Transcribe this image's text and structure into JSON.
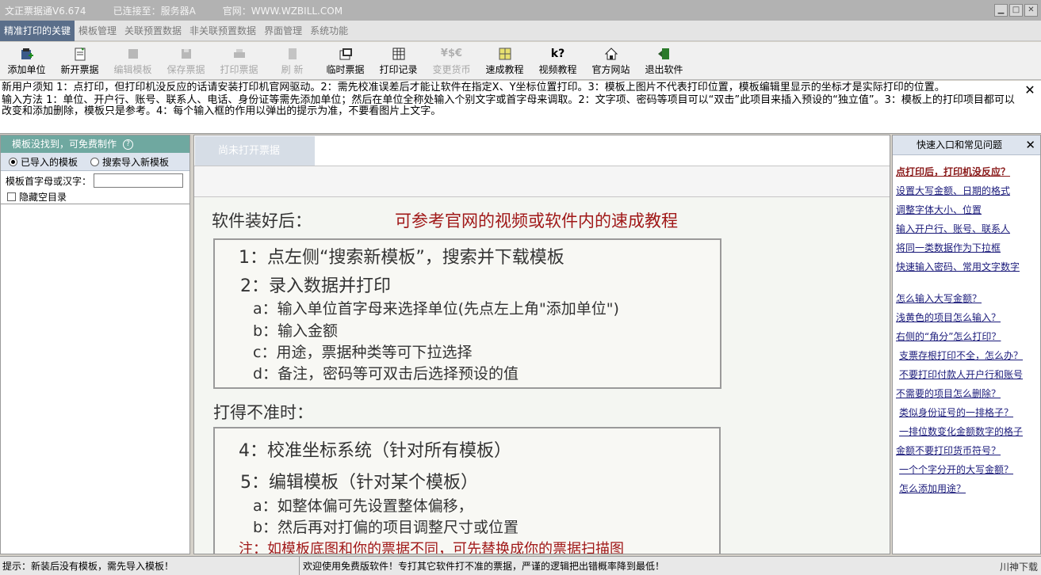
{
  "titlebar": {
    "app_title": "文正票据通V6.674",
    "connection": "已连接至：服务器A",
    "website": "官网：WWW.WZBILL.COM",
    "minimize": "▁",
    "restore": "□",
    "close": "✕"
  },
  "menubar": {
    "items": [
      "精准打印的关键",
      "模板管理",
      "关联预置数据",
      "非关联预置数据",
      "界面管理",
      "系统功能"
    ]
  },
  "toolbar": {
    "buttons": [
      {
        "label": "添加单位",
        "icon": "add-unit-icon"
      },
      {
        "label": "新开票据",
        "icon": "new-bill-icon"
      },
      {
        "label": "编辑模板",
        "icon": "edit-template-icon"
      },
      {
        "label": "保存票据",
        "icon": "save-bill-icon"
      },
      {
        "label": "打印票据",
        "icon": "print-bill-icon"
      },
      {
        "label": "刷 新",
        "icon": "refresh-icon"
      },
      {
        "label": "临时票据",
        "icon": "temp-bill-icon"
      },
      {
        "label": "打印记录",
        "icon": "print-record-icon"
      },
      {
        "label": "变更货币",
        "icon": "currency-icon"
      },
      {
        "label": "速成教程",
        "icon": "tutorial-icon"
      },
      {
        "label": "视频教程",
        "icon": "video-tutorial-icon"
      },
      {
        "label": "官方网站",
        "icon": "home-icon"
      },
      {
        "label": "退出软件",
        "icon": "exit-icon"
      }
    ]
  },
  "notice": {
    "line1": "新用户须知 1：点打印，但打印机没反应的话请安装打印机官网驱动。2：需先校准误差后才能让软件在指定X、Y坐标位置打印。3：模板上图片不代表打印位置，模板编辑里显示的坐标才是实际打印的位置。",
    "line2": "输入方法 1：单位、开户行、账号、联系人、电话、身份证等需先添加单位；然后在单位全称处输入个别文字或首字母来调取。2：文字项、密码等项目可以“双击”此项目来插入预设的“独立值”。3：模板上的打印项目都可以改变和添加删除，模板只是参考。4：每个输入框的作用以弹出的提示为准，不要看图片上文字。",
    "close": "✕"
  },
  "left_panel": {
    "header": "模板没找到，可免费制作",
    "help": "?",
    "radio_imported": "已导入的模板",
    "radio_search": "搜索导入新模板",
    "search_label": "模板首字母或汉字：",
    "search_value": "",
    "hide_empty": "隐藏空目录"
  },
  "center": {
    "tab": "尚未打开票据",
    "after_install": "软件装好后：",
    "hint_red": "可参考官网的视频或软件内的速成教程",
    "step1": "1：点左侧“搜索新模板”，搜索并下载模板",
    "step2": "2：录入数据并打印",
    "sub_a": "a：输入单位首字母来选择单位(先点左上角\"添加单位\")",
    "sub_b": "b：输入金额",
    "sub_c": "c：用途，票据种类等可下拉选择",
    "sub_d": "d：备注，密码等可双击后选择预设的值",
    "inaccurate": "打得不准时：",
    "step4": "4：校准坐标系统（针对所有模板）",
    "step5": "5：编辑模板（针对某个模板）",
    "sub5_a": "a：如整体偏可先设置整体偏移，",
    "sub5_b": "b：然后再对打偏的项目调整尺寸或位置",
    "note_red": "注：如模板底图和你的票据不同，可先替换成你的票据扫描图"
  },
  "right_panel": {
    "header": "快速入口和常见问题",
    "close": "✕",
    "links": [
      "点打印后，打印机没反应？",
      "设置大写金额、日期的格式",
      "调整字体大小、位置",
      "输入开户行、账号、联系人",
      "将同一类数据作为下拉框",
      "快速输入密码、常用文字数字",
      "怎么输入大写金额？",
      "浅黄色的项目怎么输入？",
      "右侧的“角分”怎么打印？",
      "支票存根打印不全，怎么办？",
      "不要打印付款人开户行和账号",
      "不需要的项目怎么删除？",
      "类似身份证号的一排格子？",
      "一排位数变化金额数字的格子",
      "金额不要打印货币符号？",
      "一个个字分开的大写金额？",
      "怎么添加用途？"
    ]
  },
  "status": {
    "left": "提示：新装后没有模板，需先导入模板！",
    "right": "欢迎使用免费版软件！专打其它软件打不准的票据，严谨的逻辑把出错概率降到最低！",
    "watermark": "川神下载"
  },
  "colors": {
    "menu_active": "#5a6e8a",
    "left_header": "#6fa8a0",
    "red_text": "#a01818",
    "link": "#1a1a7a"
  }
}
